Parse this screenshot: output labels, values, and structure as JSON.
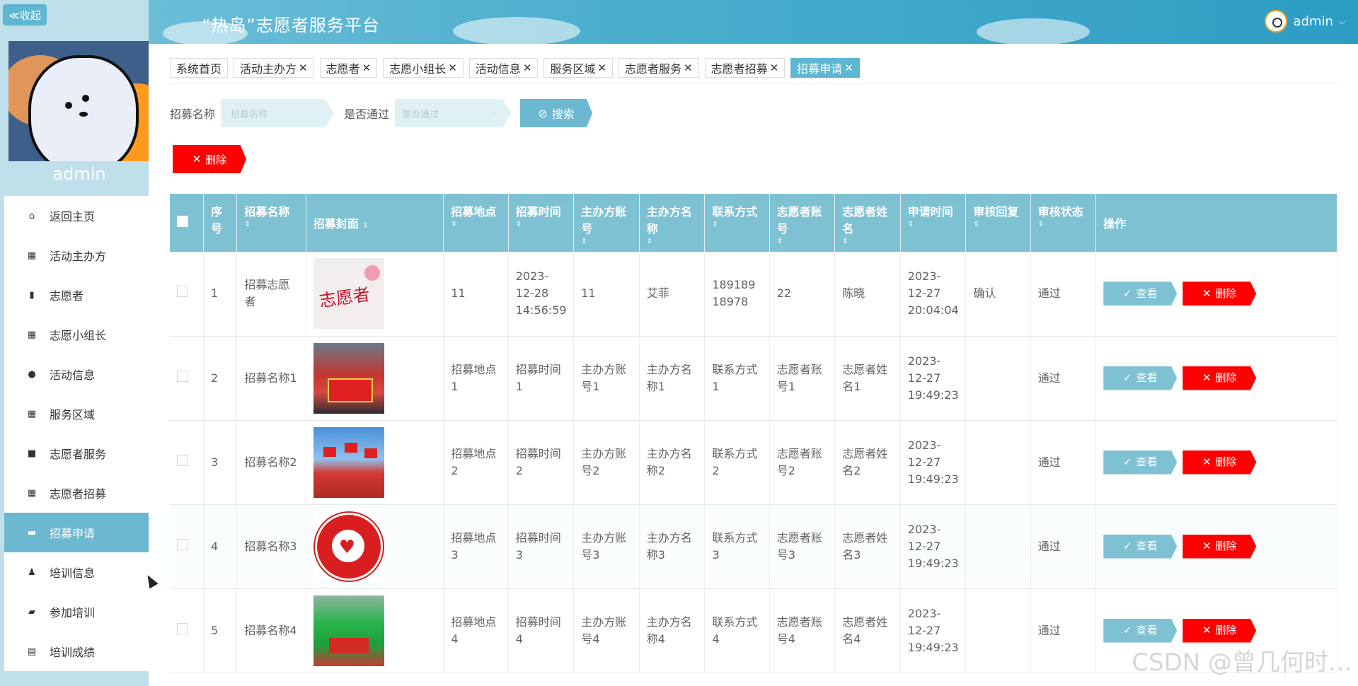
{
  "header": {
    "title": "“热岛”志愿者服务平台",
    "username": "admin",
    "collapse_label": "≪收起"
  },
  "sidebar": {
    "profile_name": "admin",
    "items": [
      {
        "label": "返回主页",
        "icon": "home-icon"
      },
      {
        "label": "活动主办方",
        "icon": "grid-icon"
      },
      {
        "label": "志愿者",
        "icon": "chart-icon"
      },
      {
        "label": "志愿小组长",
        "icon": "grid-icon"
      },
      {
        "label": "活动信息",
        "icon": "bulb-icon"
      },
      {
        "label": "服务区域",
        "icon": "grid-icon"
      },
      {
        "label": "志愿者服务",
        "icon": "video-icon"
      },
      {
        "label": "志愿者招募",
        "icon": "grid-icon"
      },
      {
        "label": "招募申请",
        "icon": "briefcase-icon",
        "active": true
      },
      {
        "label": "培训信息",
        "icon": "user-icon"
      },
      {
        "label": "参加培训",
        "icon": "chat-icon"
      },
      {
        "label": "培训成绩",
        "icon": "clipboard-icon"
      }
    ]
  },
  "tabs": [
    {
      "label": "系统首页",
      "closable": false
    },
    {
      "label": "活动主办方",
      "closable": true
    },
    {
      "label": "志愿者",
      "closable": true
    },
    {
      "label": "志愿小组长",
      "closable": true
    },
    {
      "label": "活动信息",
      "closable": true
    },
    {
      "label": "服务区域",
      "closable": true
    },
    {
      "label": "志愿者服务",
      "closable": true
    },
    {
      "label": "志愿者招募",
      "closable": true
    },
    {
      "label": "招募申请",
      "closable": true,
      "active": true
    }
  ],
  "search": {
    "name_label": "招募名称",
    "name_placeholder": "招募名称",
    "pass_label": "是否通过",
    "pass_placeholder": "是否通过",
    "search_button": "搜索"
  },
  "toolbar": {
    "delete_button": "删除"
  },
  "table": {
    "headers": [
      "序号",
      "招募名称",
      "招募封面",
      "招募地点",
      "招募时间",
      "主办方账号",
      "主办方名称",
      "联系方式",
      "志愿者账号",
      "志愿者姓名",
      "申请时间",
      "审核回复",
      "审核状态",
      "操作"
    ],
    "view_label": "查看",
    "delete_label": "删除",
    "rows": [
      {
        "no": "1",
        "name": "招募志愿者",
        "cover": "cover-volunteer-logo",
        "place": "11",
        "time": "2023-12-28 14:56:59",
        "host_account": "11",
        "host_name": "艾菲",
        "contact": "18918918978",
        "vol_account": "22",
        "vol_name": "陈晓",
        "apply_time": "2023-12-27 20:04:04",
        "reply": "确认",
        "status": "通过"
      },
      {
        "no": "2",
        "name": "招募名称1",
        "cover": "cover-group-photo",
        "place": "招募地点1",
        "time": "招募时间1",
        "host_account": "主办方账号1",
        "host_name": "主办方名称1",
        "contact": "联系方式1",
        "vol_account": "志愿者账号1",
        "vol_name": "志愿者姓名1",
        "apply_time": "2023-12-27 19:49:23",
        "reply": "",
        "status": "通过"
      },
      {
        "no": "3",
        "name": "招募名称2",
        "cover": "cover-flags-photo",
        "place": "招募地点2",
        "time": "招募时间2",
        "host_account": "主办方账号2",
        "host_name": "主办方名称2",
        "contact": "联系方式2",
        "vol_account": "志愿者账号2",
        "vol_name": "志愿者姓名2",
        "apply_time": "2023-12-27 19:49:23",
        "reply": "",
        "status": "通过"
      },
      {
        "no": "4",
        "name": "招募名称3",
        "cover": "cover-heart-emblem",
        "place": "招募地点3",
        "time": "招募时间3",
        "host_account": "主办方账号3",
        "host_name": "主办方名称3",
        "contact": "联系方式3",
        "vol_account": "志愿者账号3",
        "vol_name": "志愿者姓名3",
        "apply_time": "2023-12-27 19:49:23",
        "reply": "",
        "status": "通过"
      },
      {
        "no": "5",
        "name": "招募名称4",
        "cover": "cover-green-team",
        "place": "招募地点4",
        "time": "招募时间4",
        "host_account": "主办方账号4",
        "host_name": "主办方名称4",
        "contact": "联系方式4",
        "vol_account": "志愿者账号4",
        "vol_name": "志愿者姓名4",
        "apply_time": "2023-12-27 19:49:23",
        "reply": "",
        "status": "通过"
      }
    ]
  },
  "watermark": "CSDN @曾几何时…",
  "colors": {
    "accent": "#6cb8d0",
    "danger": "#ff0000",
    "header_bg": "#7ec1d3"
  }
}
